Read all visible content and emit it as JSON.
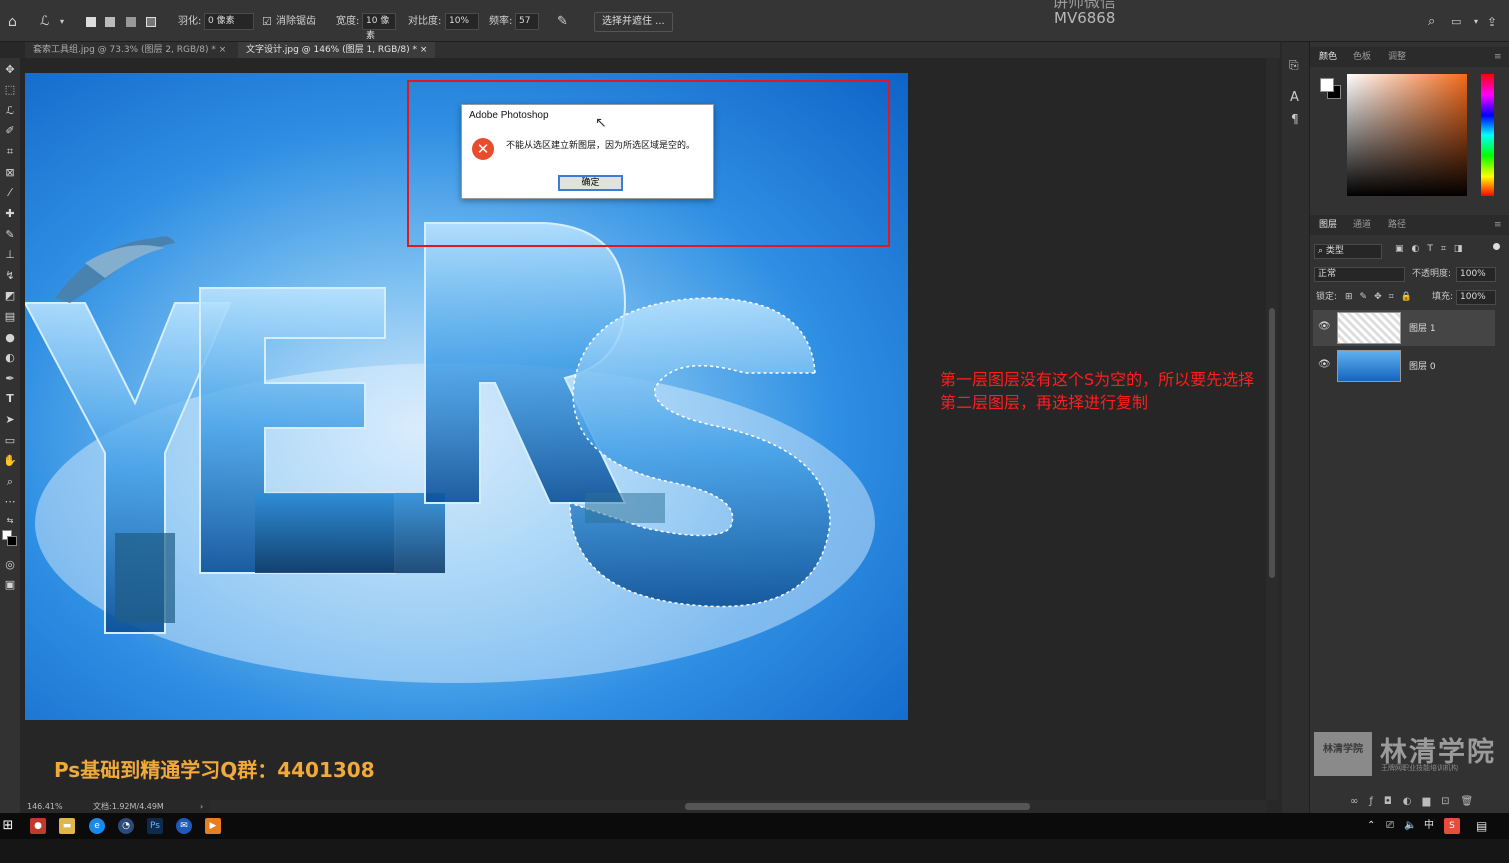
{
  "watermark_top": {
    "line1": "讲师微信",
    "line2": "MV6868"
  },
  "options_bar": {
    "feather_label": "羽化:",
    "feather_value": "0 像素",
    "antialias_label": "消除锯齿",
    "width_label": "宽度:",
    "width_value": "10 像素",
    "contrast_label": "对比度:",
    "contrast_value": "10%",
    "frequency_label": "频率:",
    "frequency_value": "57",
    "select_mask_button": "选择并遮住 ..."
  },
  "tabs": [
    {
      "label": "套索工具组.jpg @ 73.3% (图层 2, RGB/8) *",
      "close": "×"
    },
    {
      "label": "文字设计.jpg @ 146% (图层 1, RGB/8) *",
      "close": "×"
    }
  ],
  "dialog": {
    "title": "Adobe Photoshop",
    "message": "不能从选区建立新图层，因为所选区域是空的。",
    "ok_label": "确定",
    "icon": "error-x-icon"
  },
  "annotation": {
    "line1": "第一层图层没有这个S为空的，所以要先选择",
    "line2": "第二层图层，再选择进行复制",
    "color": "#ff1e1e"
  },
  "qq_banner": "Ps基础到精通学习Q群：4401308",
  "status": {
    "zoom": "146.41%",
    "doc": "文档:1.92M/4.49M"
  },
  "color_panel": {
    "tabs": [
      "颜色",
      "色板",
      "调整"
    ]
  },
  "layers_panel": {
    "tabs": [
      "图层",
      "通道",
      "路径"
    ],
    "filter_label": "类型",
    "blend_mode": "正常",
    "opacity_label": "不透明度:",
    "opacity_value": "100%",
    "lock_label": "锁定:",
    "fill_label": "填充:",
    "fill_value": "100%",
    "layers": [
      {
        "name": "图层 1",
        "selected": true
      },
      {
        "name": "图层 0",
        "selected": false
      }
    ]
  },
  "logo_watermark": {
    "badge": "林清学院",
    "name": "林清学院",
    "sub": "王牌网职业技能培训机构"
  },
  "taskbar": {
    "ime": "中"
  },
  "colors": {
    "red_box": "#e3171d",
    "banner": "#f2a93b",
    "accent": "#3d7bd9"
  }
}
